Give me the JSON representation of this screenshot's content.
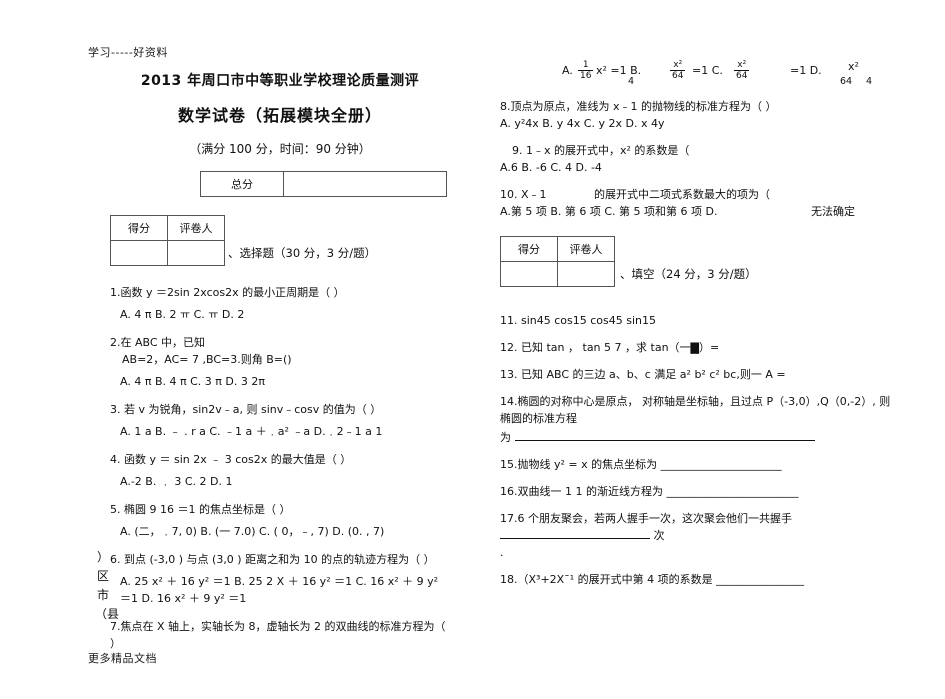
{
  "header": {
    "watermark_top": "学习-----好资料",
    "watermark_bottom": "更多精品文档"
  },
  "side_vertical": "）区市（县",
  "titles": {
    "line1": "2013 年周口市中等职业学校理论质量测评",
    "line2": "数学试卷（拓展模块全册）",
    "line3": "（满分 100 分，时间：90 分钟）"
  },
  "score_table": {
    "label": "总分"
  },
  "grade_table": {
    "score_label": "得分",
    "marker_label": "评卷人"
  },
  "section1": {
    "label": "、选择题（30 分，3 分/题）"
  },
  "section2": {
    "label": "、填空（24 分，3 分/题）"
  },
  "left_questions": [
    {
      "stem": "1.函数 y ＝2sin 2xcos2x 的最小正周期是（ ）",
      "options": "A. 4 π  B.  2 ㅠ  C. ㅠ  D.  2"
    },
    {
      "stem": "2.在 ABC 中，已知",
      "stem2": "AB=2，AC= 7 ,BC=3.则角    B=()",
      "options": "A. 4 π  B. 4 π  C. 3 π  D. 3 2π"
    },
    {
      "stem": "3. 若 v 为锐角，sin2v﹣a, 则 sinv﹣cosv 的值为（   ）",
      "options": "A. 1 a B. ﹣ . r          a C. ﹣1 a ＋﹒a² ﹣a D.﹒2﹣1 a 1"
    },
    {
      "stem": "4. 函数 y ＝ sin 2x    ﹣ 3 cos2x 的最大值是（   ）",
      "options": "A.-2 B.    ﹒ 3 C. 2 D. 1"
    },
    {
      "stem": "5. 椭圆 9  16 ＝1 的焦点坐标是（   ）",
      "options": "A. (二，﹒7, 0) B. (一 7.0) C. ( 0，﹣, 7) D. (0.    ,   7)"
    },
    {
      "stem": "6. 到点 (-3,0 ) 与点 (3,0 ) 距离之和为 10 的点的轨迹方程为（       ）",
      "options": "A. 25 x² ＋ 16 y² ＝1 B. 25 2 X ＋ 16 y² ＝1 C. 16 x² ＋ 9 y² ＝1 D. 16 x² ＋ 9 y² ＝1"
    },
    {
      "stem": "7.焦点在 X 轴上，实轴长为 8，虚轴长为 2 的双曲线的标准方程为（ ）"
    }
  ],
  "right_top_options": {
    "a_label": "A.",
    "a_frac_num": "1",
    "a_frac_den": "16",
    "a_rest": "x² =1 B.",
    "b_frac_num": "x²",
    "b_frac_den": "64",
    "b_rest": "=1 C.",
    "c_frac_num": "x²",
    "c_frac_den": "64",
    "c_rest": "=1 D.",
    "d_frac_num": "x²",
    "d_den_left": "64",
    "d_den_right": "4",
    "trailing": "4"
  },
  "right_questions": [
    {
      "stem": "8.顶点为原点，准线为  x﹣1 的抛物线的标准方程为（       ）",
      "options": "A. y²4x B. y 4x C. y 2x D. x 4y"
    },
    {
      "stem": "9. 1﹣x 的展开式中，x² 的系数是（",
      "options": "A.6 B. -6 C. 4 D. -4"
    },
    {
      "stem": "10.  X﹣1",
      "stem_rest": "的展开式中二项式系数最大的项为（",
      "options": "A.第 5 项 B. 第 6 项 C. 第 5 项和第 6 项 D.",
      "options_tail": "无法确定"
    }
  ],
  "fill_questions": [
    "11. sin45 cos15 cos45 sin15",
    "12. 已知 tan ， tan  5      7 ，求 tan（一▇）=",
    "13. 已知  ABC 的三边 a、b、c 满足 a² b² c² bc,则一 A =",
    "14.椭圆的对称中心是原点，      对称轴是坐标轴，且过点 P（-3,0）,Q（0,-2）, 则椭圆的标准方程",
    "为",
    "15.抛物线  y² = x 的焦点坐标为  ______________________",
    "16.双曲线一 1 1 的渐近线方程为 ________________________",
    "17.6 个朋友聚会，若两人握手一次，这次聚会他们一共握手",
    "18.（X³+2X¯¹ 的展开式中第 4 项的系数是 ________________"
  ],
  "fill_tail": {
    "q17_unit": "次",
    "q17_dot": "."
  }
}
